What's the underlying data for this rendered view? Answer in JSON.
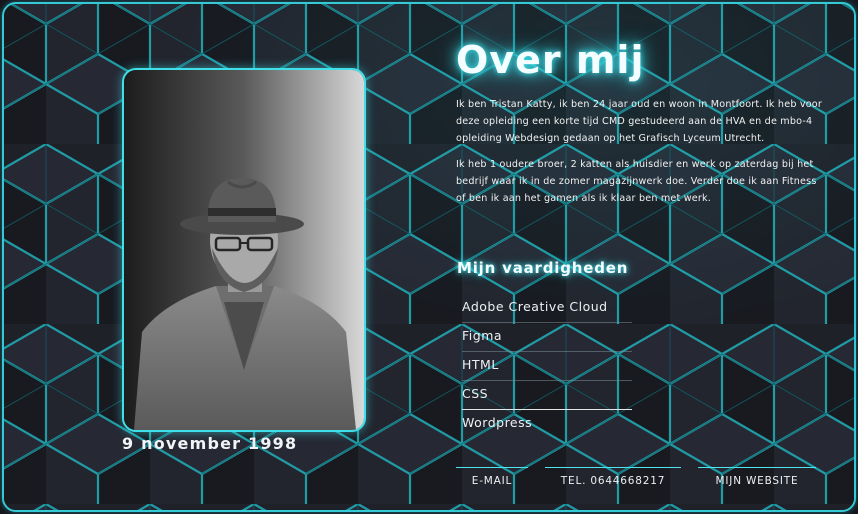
{
  "title": "Over mij",
  "bio": {
    "paragraph_1": "Ik ben Tristan Katty, ik ben 24 jaar oud en woon in Montfoort. Ik heb voor deze opleiding een korte tijd CMD gestudeerd aan de HVA en de mbo-4 opleiding Webdesign gedaan op het Grafisch Lyceum Utrecht.",
    "paragraph_2": "Ik heb 1 oudere broer, 2 katten als huisdier en werk op zaterdag bij het bedrijf waar ik in de zomer magazijnwerk doe. Verder doe ik aan Fitness of ben ik aan het gamen als ik klaar ben met werk."
  },
  "photo": {
    "caption": "9 november 1998"
  },
  "skills": {
    "heading": "Mijn vaardigheden",
    "items": [
      "Adobe Creative Cloud",
      "Figma",
      "HTML",
      "CSS",
      "Wordpress"
    ]
  },
  "contact": {
    "email": "E-MAIL",
    "phone": "TEL. 0644668217",
    "website": "MIJN WEBSITE"
  },
  "colors": {
    "accent": "#34c9d4",
    "background": "#1b1d24",
    "text": "#f2f2f2"
  }
}
